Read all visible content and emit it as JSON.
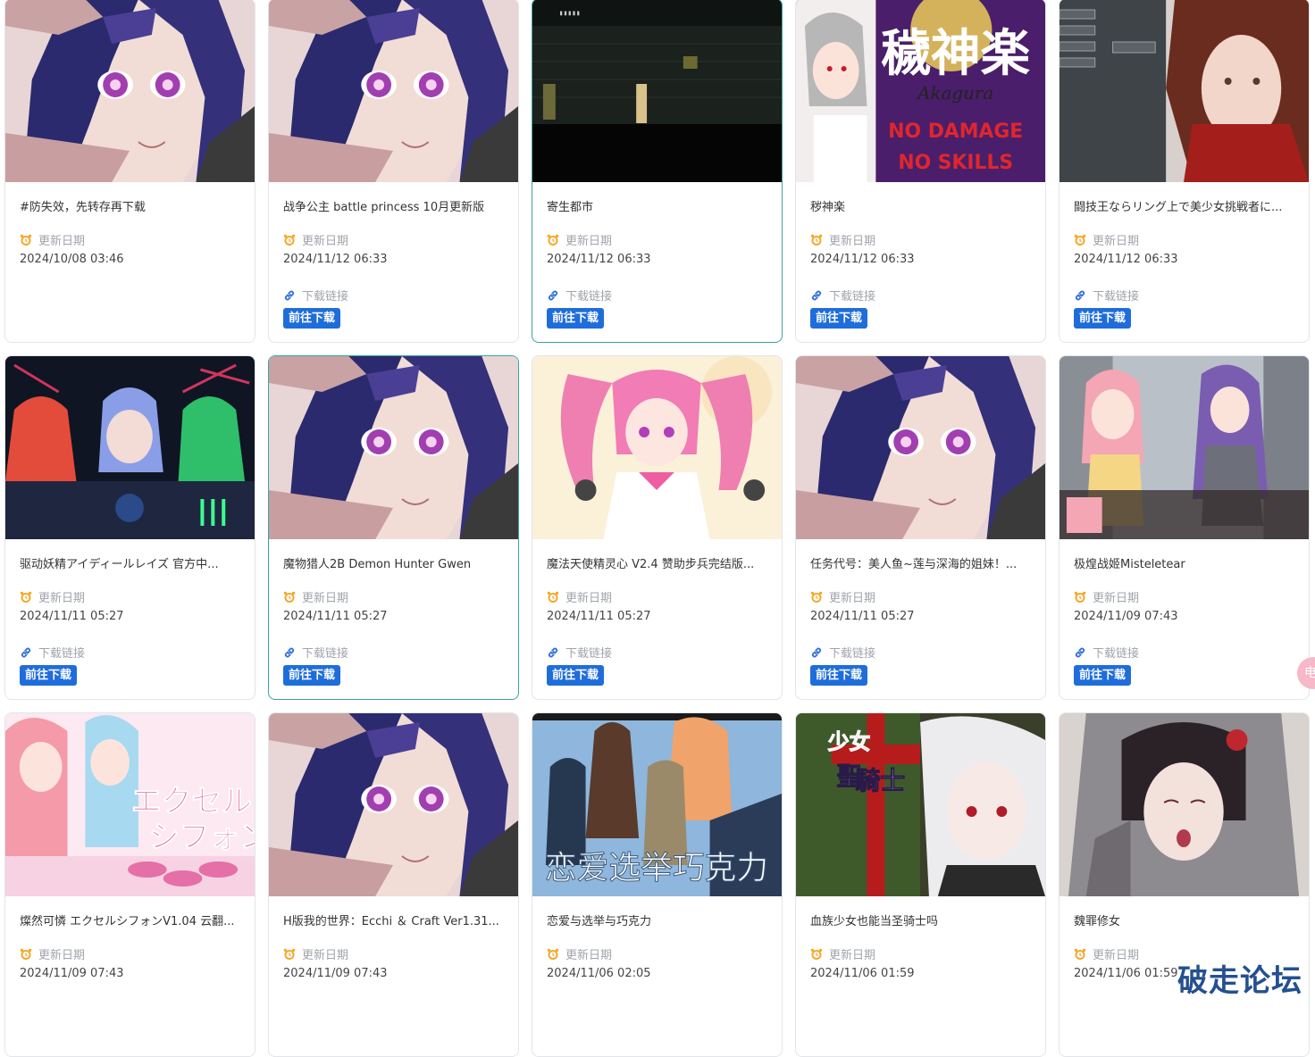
{
  "labels": {
    "update_date": "更新日期",
    "download_link": "下载链接",
    "go_download": "前往下载"
  },
  "colors": {
    "accent": "#1f6ddb",
    "active_border": "#3aa59b",
    "alarm_icon": "#f5a623",
    "link_icon": "#2f6fd6"
  },
  "cards": [
    {
      "title": "#防失效，先转存再下载",
      "date": "2024/10/08 03:46",
      "has_link": false,
      "art": "anime-eyes",
      "active": false
    },
    {
      "title": "战争公主 battle princess 10月更新版",
      "date": "2024/11/12 06:33",
      "has_link": true,
      "art": "anime-eyes",
      "active": false
    },
    {
      "title": "寄生都市",
      "date": "2024/11/12 06:33",
      "has_link": true,
      "art": "dark-alley",
      "active": true
    },
    {
      "title": "秽神楽",
      "date": "2024/11/12 06:33",
      "has_link": true,
      "art": "kagura",
      "active": false
    },
    {
      "title": "闘技王ならリング上で美少女挑戦者に...",
      "date": "2024/11/12 06:33",
      "has_link": true,
      "art": "red-lady",
      "active": false
    },
    {
      "title": "驱动妖精アイディールレイズ 官方中...",
      "date": "2024/11/11 05:27",
      "has_link": true,
      "art": "neon-mecha",
      "active": false
    },
    {
      "title": "魔物猎人2B Demon Hunter Gwen",
      "date": "2024/11/11 05:27",
      "has_link": true,
      "art": "anime-eyes",
      "active": true
    },
    {
      "title": "魔法天使精灵心 V2.4 赞助步兵完结版...",
      "date": "2024/11/11 05:27",
      "has_link": true,
      "art": "pink-magical",
      "active": false
    },
    {
      "title": "任务代号：美人鱼~莲与深海的姐妹！...",
      "date": "2024/11/11 05:27",
      "has_link": true,
      "art": "anime-eyes",
      "active": false
    },
    {
      "title": "极煌战姬Misteletear",
      "date": "2024/11/09 07:43",
      "has_link": true,
      "art": "street-girls",
      "active": false
    },
    {
      "title": "燦然可憐 エクセルシフォンV1.04 云翻...",
      "date": "2024/11/09 07:43",
      "has_link": false,
      "art": "excel-chiffon",
      "active": false
    },
    {
      "title": "H版我的世界：Ecchi ＆ Craft Ver1.31...",
      "date": "2024/11/09 07:43",
      "has_link": false,
      "art": "anime-eyes",
      "active": false
    },
    {
      "title": "恋爱与选举与巧克力",
      "date": "2024/11/06 02:05",
      "has_link": false,
      "art": "school-choco",
      "active": false
    },
    {
      "title": "血族少女也能当圣骑士吗",
      "date": "2024/11/06 01:59",
      "has_link": false,
      "art": "white-paladin",
      "active": false
    },
    {
      "title": "魏罪修女",
      "date": "2024/11/06 01:59",
      "has_link": false,
      "art": "gray-nun",
      "active": false
    }
  ],
  "art_text": {
    "kagura_title": "穢神楽",
    "kagura_sub": "Akagura",
    "kagura_line1": "NO DAMAGE",
    "kagura_line2": "NO SKILLS",
    "excel_title": "エクセルシフォン",
    "choco_title": "恋爱选举巧克力",
    "paladin_title": "少女聖騎士"
  },
  "float_badge": "电",
  "watermark": "破走论坛"
}
